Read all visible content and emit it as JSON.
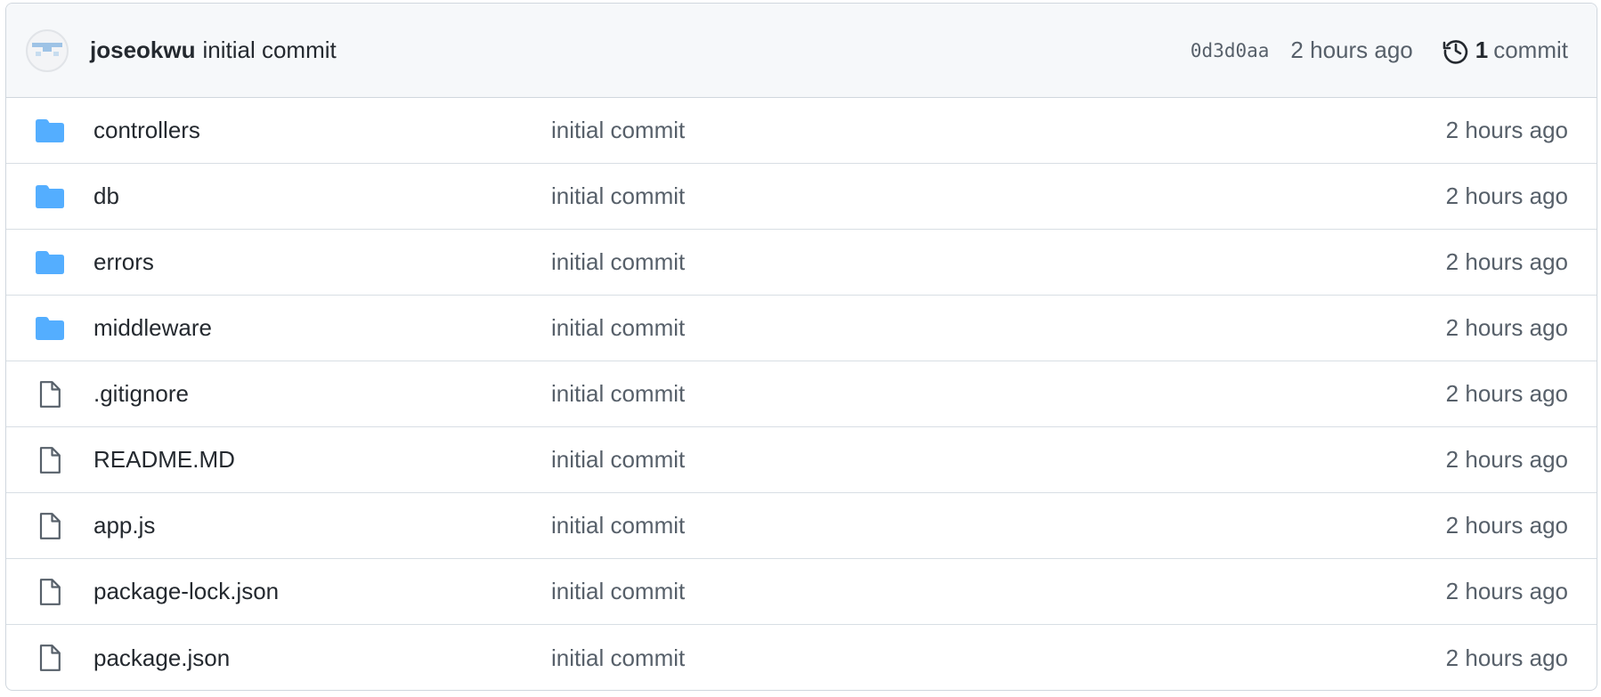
{
  "header": {
    "author": "joseokwu",
    "commit_message": "initial commit",
    "sha": "0d3d0aa",
    "time": "2 hours ago",
    "commit_count": "1",
    "commit_label": "commit"
  },
  "files": [
    {
      "name": "controllers",
      "type": "folder",
      "message": "initial commit",
      "time": "2 hours ago"
    },
    {
      "name": "db",
      "type": "folder",
      "message": "initial commit",
      "time": "2 hours ago"
    },
    {
      "name": "errors",
      "type": "folder",
      "message": "initial commit",
      "time": "2 hours ago"
    },
    {
      "name": "middleware",
      "type": "folder",
      "message": "initial commit",
      "time": "2 hours ago"
    },
    {
      "name": ".gitignore",
      "type": "file",
      "message": "initial commit",
      "time": "2 hours ago"
    },
    {
      "name": "README.MD",
      "type": "file",
      "message": "initial commit",
      "time": "2 hours ago"
    },
    {
      "name": "app.js",
      "type": "file",
      "message": "initial commit",
      "time": "2 hours ago"
    },
    {
      "name": "package-lock.json",
      "type": "file",
      "message": "initial commit",
      "time": "2 hours ago"
    },
    {
      "name": "package.json",
      "type": "file",
      "message": "initial commit",
      "time": "2 hours ago"
    }
  ],
  "colors": {
    "folder": "#54aeff",
    "file_icon": "#57606a",
    "header_bg": "#f6f8fa",
    "border": "#d0d7de"
  },
  "icons": {
    "folder": "folder-icon",
    "file": "file-icon",
    "history": "history-icon",
    "avatar": "avatar-identicon"
  }
}
